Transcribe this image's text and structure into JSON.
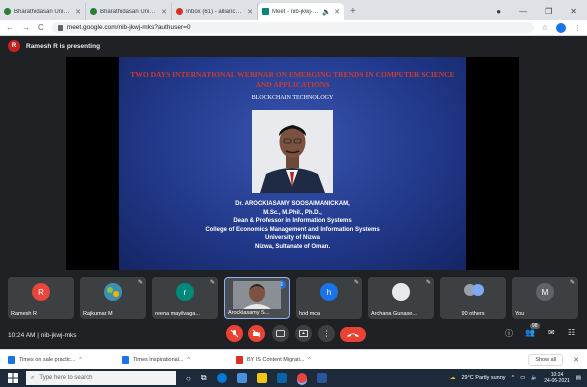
{
  "browser": {
    "tabs": [
      {
        "title": "Bharathidasan University, Truch",
        "fav": "#2e7d32"
      },
      {
        "title": "Bharathidasan University, Truch",
        "fav": "#2e7d32"
      },
      {
        "title": "Inbox (61) - alliance.ssoit@gmail.com",
        "fav": "#d93025"
      },
      {
        "title": "Meet - nib-jkwj-mks",
        "fav": "#00897b"
      }
    ],
    "active_tab_speaker": "◀ᵢ",
    "url": "meet.google.com/nib-jkwj-mks?authuser=0"
  },
  "meet": {
    "presenter_initial": "R",
    "presenter_label": "Ramesh R is presenting",
    "slide": {
      "title": "TWO DAYS INTERNATIONAL WEBINAR ON EMERGING TRENDS IN COMPUTER SCIENCE AND APPLICATIONS",
      "subtitle": "BLOCKCHAIN TECHNOLOGY",
      "lines": [
        "Dr. AROCKIASAMY SOOSAIMANICKAM,",
        "M.Sc., M.Phil., Ph.D.,",
        "Dean & Professor in Information Systems",
        "College of Economics Management and Information Systems",
        "University of Nizwa",
        "Nizwa, Sultanate of Oman."
      ]
    },
    "participants": [
      {
        "name": "Ramesh R",
        "initial": "R",
        "color": "#e8453c"
      },
      {
        "name": "Rajkumar M",
        "initial": "",
        "color": "#2e7d9a"
      },
      {
        "name": "reena mayilvaga...",
        "initial": "r",
        "color": "#00897b"
      },
      {
        "name": "Arockiasamy S...",
        "initial": "",
        "color": "#5f6368"
      },
      {
        "name": "hod mca",
        "initial": "h",
        "color": "#1a73e8"
      },
      {
        "name": "Archana Gunase...",
        "initial": "",
        "color": "#e8eaed"
      },
      {
        "name": "90 others",
        "initial": "",
        "color": "#5f6368"
      },
      {
        "name": "You",
        "initial": "M",
        "color": "#5f6368"
      }
    ],
    "time": "10:24 AM",
    "meeting_code": "nib-jkwj-mks",
    "people_count": "98"
  },
  "downloads": [
    {
      "name": "Times on sale practic...",
      "color": "#1a73e8"
    },
    {
      "name": "Times Inspirational...",
      "color": "#1a73e8"
    },
    {
      "name": "BY IS Content Migrati...",
      "color": "#d93025"
    }
  ],
  "downloads_show_all": "Show all",
  "taskbar": {
    "search_placeholder": "Type here to search",
    "weather": "29°C Partly sunny",
    "clock_time": "10:24",
    "clock_date": "24-06-2021"
  },
  "colors": {
    "meet_bg": "#202124",
    "end_call": "#ea4335",
    "accent": "#8ab4f8"
  }
}
